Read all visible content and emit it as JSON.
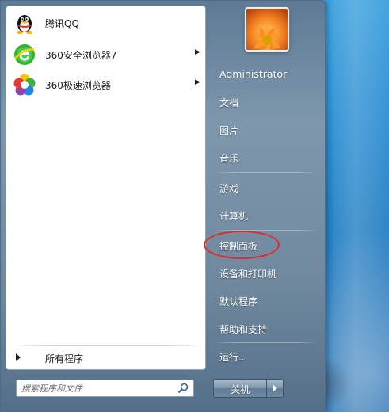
{
  "pinned_programs": [
    {
      "label": "腾讯QQ",
      "icon": "qq-penguin-icon",
      "has_submenu": false
    },
    {
      "label": "360安全浏览器7",
      "icon": "360-browser-icon",
      "has_submenu": true
    },
    {
      "label": "360极速浏览器",
      "icon": "360-speed-browser-icon",
      "has_submenu": true
    }
  ],
  "all_programs_label": "所有程序",
  "search": {
    "placeholder": "搜索程序和文件"
  },
  "user": {
    "name": "Administrator",
    "picture": "flower-picture"
  },
  "right_items": {
    "documents": "文档",
    "pictures": "图片",
    "music": "音乐",
    "games": "游戏",
    "computer": "计算机",
    "control_panel": "控制面板",
    "devices_printers": "设备和打印机",
    "default_programs": "默认程序",
    "help_support": "帮助和支持",
    "run": "运行..."
  },
  "shutdown": {
    "label": "关机"
  },
  "colors": {
    "highlight_ring": "#e02a2a",
    "menu_right": "#6f889e"
  }
}
